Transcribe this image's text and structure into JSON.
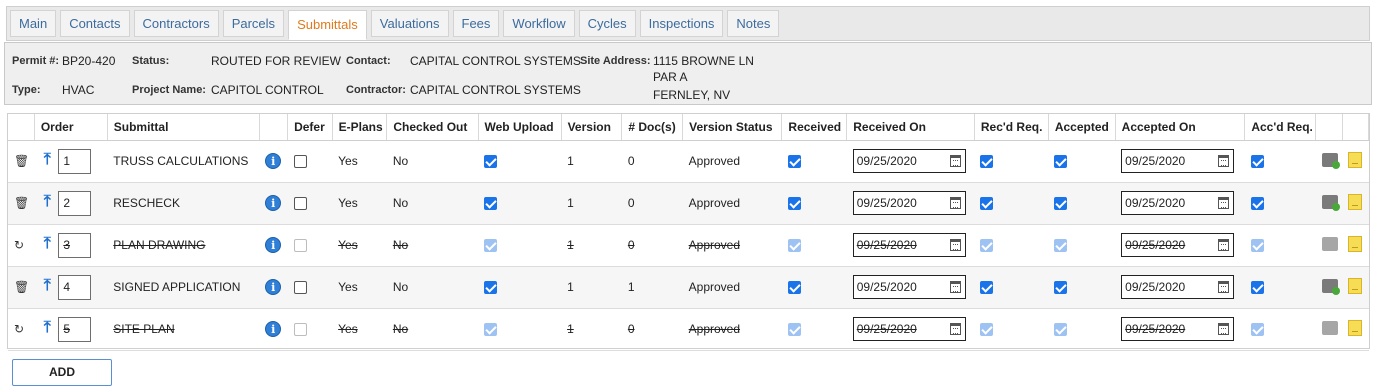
{
  "tabs": [
    "Main",
    "Contacts",
    "Contractors",
    "Parcels",
    "Submittals",
    "Valuations",
    "Fees",
    "Workflow",
    "Cycles",
    "Inspections",
    "Notes"
  ],
  "active_tab": "Submittals",
  "info": {
    "permit_label": "Permit #:",
    "permit_value": "BP20-420",
    "status_label": "Status:",
    "status_value": "ROUTED FOR REVIEW",
    "contact_label": "Contact:",
    "contact_value": "CAPITAL CONTROL SYSTEMS",
    "site_label": "Site Address:",
    "site_line1": "1115 BROWNE LN",
    "site_line2": "PAR A",
    "site_line3": "FERNLEY, NV",
    "type_label": "Type:",
    "type_value": "HVAC",
    "project_label": "Project Name:",
    "project_value": "CAPITOL CONTROL",
    "contractor_label": "Contractor:",
    "contractor_value": "CAPITAL CONTROL SYSTEMS"
  },
  "columns": [
    "",
    "Order",
    "Submittal",
    "",
    "Defer",
    "E-Plans",
    "Checked Out",
    "Web Upload",
    "Version",
    "# Doc(s)",
    "Version Status",
    "Received",
    "Received On",
    "Rec'd Req.",
    "Accepted",
    "Accepted On",
    "Acc'd Req.",
    "",
    ""
  ],
  "rows": [
    {
      "action": "delete",
      "order": "1",
      "submittal": "TRUSS CALCULATIONS",
      "defer": false,
      "eplans": "Yes",
      "checked_out": "No",
      "web_upload": true,
      "version": "1",
      "docs": "0",
      "version_status": "Approved",
      "received": true,
      "received_on": "09/25/2020",
      "recd_req": true,
      "accepted": true,
      "accepted_on": "09/25/2020",
      "accd_req": true,
      "struck": false
    },
    {
      "action": "delete",
      "order": "2",
      "submittal": "RESCHECK",
      "defer": false,
      "eplans": "Yes",
      "checked_out": "No",
      "web_upload": true,
      "version": "1",
      "docs": "0",
      "version_status": "Approved",
      "received": true,
      "received_on": "09/25/2020",
      "recd_req": true,
      "accepted": true,
      "accepted_on": "09/25/2020",
      "accd_req": true,
      "struck": false
    },
    {
      "action": "restore",
      "order": "3",
      "submittal": "PLAN DRAWING",
      "defer": false,
      "eplans": "Yes",
      "checked_out": "No",
      "web_upload": true,
      "version": "1",
      "docs": "0",
      "version_status": "Approved",
      "received": true,
      "received_on": "09/25/2020",
      "recd_req": true,
      "accepted": true,
      "accepted_on": "09/25/2020",
      "accd_req": true,
      "struck": true
    },
    {
      "action": "delete",
      "order": "4",
      "submittal": "SIGNED APPLICATION",
      "defer": false,
      "eplans": "Yes",
      "checked_out": "No",
      "web_upload": true,
      "version": "1",
      "docs": "1",
      "version_status": "Approved",
      "received": true,
      "received_on": "09/25/2020",
      "recd_req": true,
      "accepted": true,
      "accepted_on": "09/25/2020",
      "accd_req": true,
      "struck": false
    },
    {
      "action": "restore",
      "order": "5",
      "submittal": "SITE PLAN",
      "defer": false,
      "eplans": "Yes",
      "checked_out": "No",
      "web_upload": true,
      "version": "1",
      "docs": "0",
      "version_status": "Approved",
      "received": true,
      "received_on": "09/25/2020",
      "recd_req": true,
      "accepted": true,
      "accepted_on": "09/25/2020",
      "accd_req": true,
      "struck": true
    }
  ],
  "icons": {
    "delete": "trash-icon",
    "restore": "undo-icon",
    "move": "arrow-up-icon",
    "info": "info-icon",
    "doc": "document-check-icon",
    "note": "sticky-note-icon",
    "calendar": "calendar-icon"
  },
  "add_button": "ADD"
}
